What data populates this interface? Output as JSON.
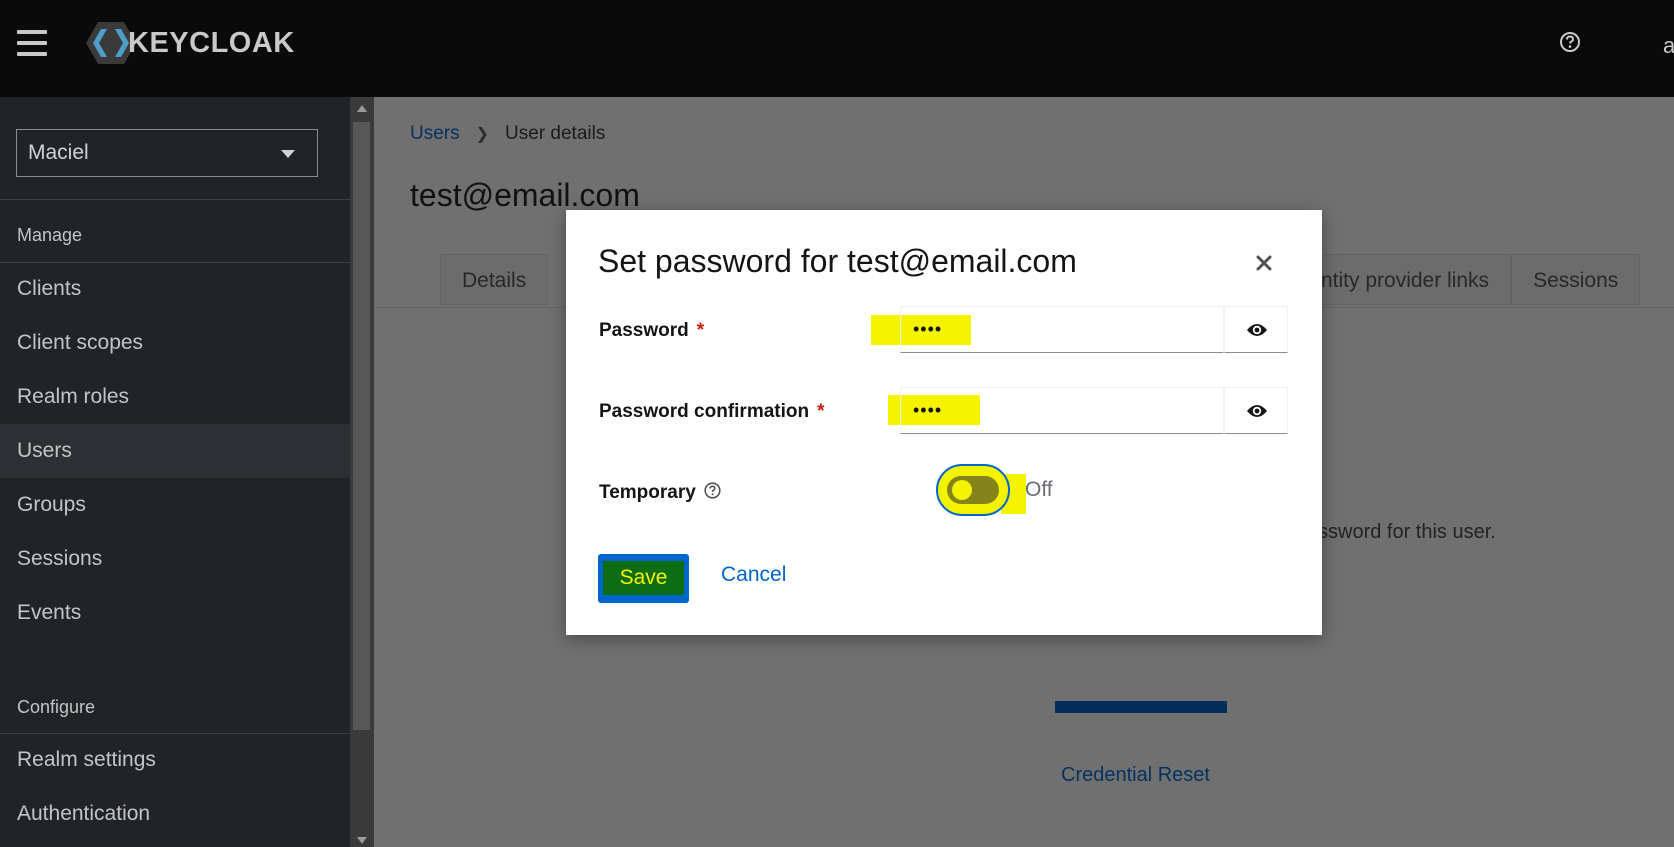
{
  "masthead": {
    "logo_text": "KEYCLOAK",
    "menu_icon": "hamburger-icon",
    "help_icon": "help-circle-icon",
    "user_truncated": "a"
  },
  "sidebar": {
    "realm": "Maciel",
    "sections": [
      {
        "label": "Manage",
        "items": [
          "Clients",
          "Client scopes",
          "Realm roles",
          "Users",
          "Groups",
          "Sessions",
          "Events"
        ]
      },
      {
        "label": "Configure",
        "items": [
          "Realm settings",
          "Authentication"
        ]
      }
    ],
    "active_item": "Users"
  },
  "page": {
    "breadcrumb": {
      "parent": "Users",
      "current": "User details"
    },
    "title": "test@email.com",
    "tabs_left": [
      "Details"
    ],
    "tabs_right": [
      "ntity provider links",
      "Sessions"
    ],
    "empty_message": "ssword for this user.",
    "credential_reset_link": "Credential Reset"
  },
  "modal": {
    "title": "Set password for test@email.com",
    "close_icon": "close-icon",
    "password_label": "Password",
    "password_value": "••••",
    "confirmation_label": "Password confirmation",
    "confirmation_value": "••••",
    "required_mark": "*",
    "eye_icon": "eye-icon",
    "temporary_label": "Temporary",
    "temporary_state": "Off",
    "save_label": "Save",
    "cancel_label": "Cancel"
  },
  "colors": {
    "highlight": "#f4f400",
    "primary": "#0066cc",
    "save_fill": "#0d6d12",
    "masthead": "#0a0a0a",
    "sidebar": "#212427"
  }
}
